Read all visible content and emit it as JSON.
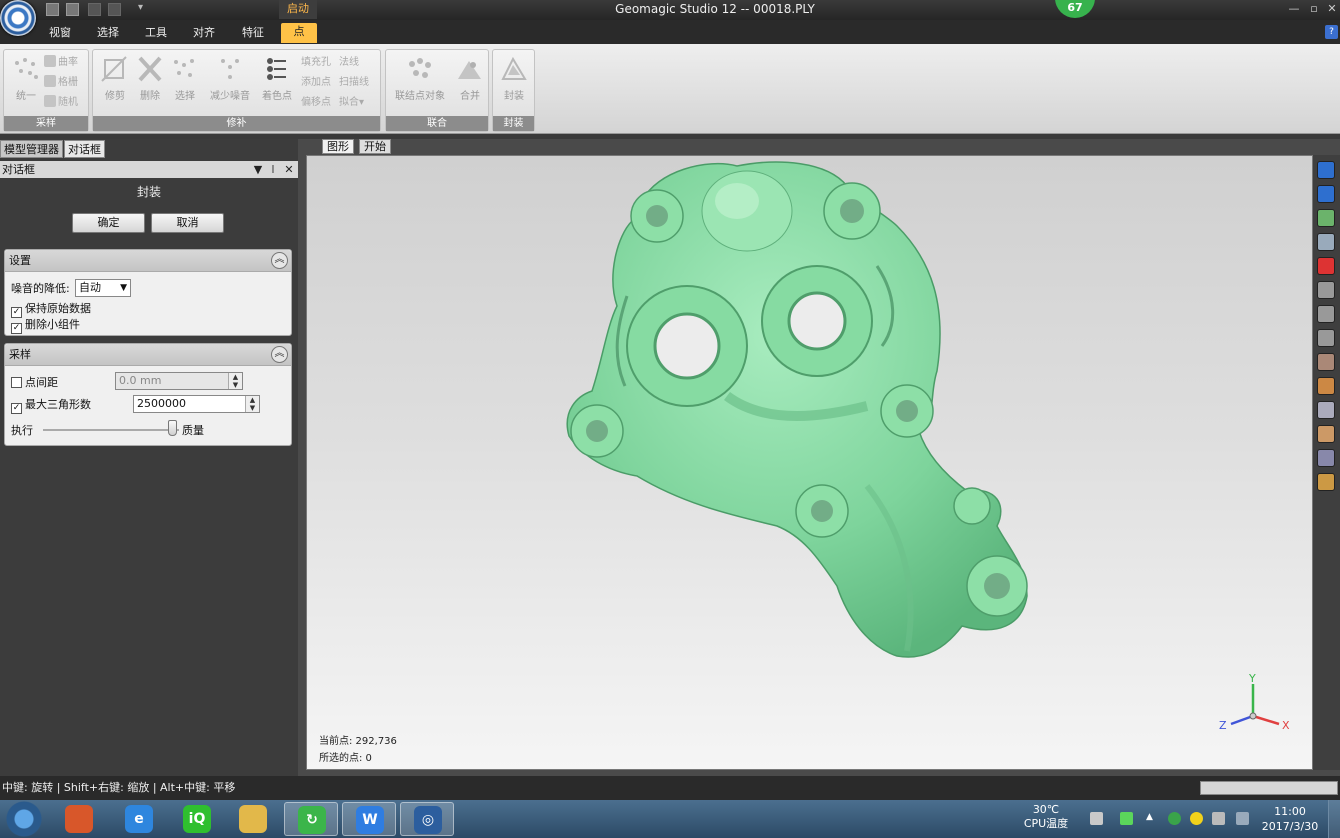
{
  "window": {
    "title": "Geomagic Studio 12 -- 00018.PLY",
    "badge": "67",
    "context_tab": "启动",
    "controls": [
      "—",
      "▫",
      "✕"
    ]
  },
  "ribbon_tabs": [
    {
      "label": "视窗"
    },
    {
      "label": "选择"
    },
    {
      "label": "工具"
    },
    {
      "label": "对齐"
    },
    {
      "label": "特征"
    },
    {
      "label": "点",
      "active": true
    }
  ],
  "help_label": "?",
  "ribbon": {
    "groups": {
      "sampling": {
        "label": "采样",
        "big": [
          "统一"
        ],
        "small": [
          "曲率",
          "格栅",
          "随机"
        ]
      },
      "repair": {
        "label": "修补",
        "big": [
          "修剪",
          "删除",
          "选择",
          "减少噪音",
          "着色点"
        ],
        "small": [
          "填充孔",
          "添加点",
          "偏移点",
          "法线",
          "扫描线",
          "拟合"
        ]
      },
      "union": {
        "label": "联合",
        "big": [
          "联结点对象",
          "合并"
        ]
      },
      "wrap": {
        "label": "封装",
        "big": [
          "封装"
        ]
      }
    }
  },
  "panel_tabs": [
    {
      "label": "模型管理器"
    },
    {
      "label": "对话框",
      "active": true
    }
  ],
  "dialog": {
    "header": "对话框",
    "header_icons": [
      "▼",
      "𝍷",
      "✕"
    ],
    "title": "封装",
    "ok": "确定",
    "cancel": "取消",
    "settings": {
      "title": "设置",
      "noise_label": "噪音的降低:",
      "noise_value": "自动",
      "keep_original": "保持原始数据",
      "remove_small": "删除小组件"
    },
    "sampling": {
      "title": "采样",
      "point_spacing_label": "点间距",
      "point_spacing_value": "0.0 mm",
      "max_triangles_label": "最大三角形数",
      "max_triangles_value": "2500000",
      "perf_label": "执行",
      "quality_label": "质量",
      "slider_value": 0.95
    }
  },
  "viewport": {
    "tabs": [
      {
        "label": "图形",
        "active": true
      },
      {
        "label": "开始"
      }
    ],
    "current_points": "当前点: 292,736",
    "selected_points": "所选的点: 0",
    "axes": {
      "x": "X",
      "y": "Y",
      "z": "Z"
    },
    "model_color": "#7ed49c",
    "toolbar_colors": [
      "#2e6fcf",
      "#2e6fcf",
      "#6bb36b",
      "#9ab",
      "#d33",
      "#999",
      "#999",
      "#999",
      "#a87",
      "#c84",
      "#aab",
      "#c96",
      "#88a",
      "#c94"
    ]
  },
  "statusbar": {
    "text": "中键: 旋转 | Shift+右键: 缩放 | Alt+中键: 平移"
  },
  "taskbar": {
    "items": [
      {
        "icon": "color-pinwheel-icon",
        "glyph": "",
        "color": "#d8572a"
      },
      {
        "icon": "ie-icon",
        "glyph": "e",
        "color": "#2e86de"
      },
      {
        "icon": "iqiyi-icon",
        "glyph": "iQ",
        "color": "#2fbf2f"
      },
      {
        "icon": "folder-icon",
        "glyph": "",
        "color": "#e2b84a"
      },
      {
        "icon": "refresh-green-icon",
        "glyph": "↻",
        "color": "#3bb54a",
        "active": true
      },
      {
        "icon": "wps-icon",
        "glyph": "W",
        "color": "#2f7de1",
        "active": true
      },
      {
        "icon": "geomagic-icon",
        "glyph": "◎",
        "color": "#2c5e9e",
        "active": true
      }
    ],
    "temp": "30℃",
    "temp_label": "CPU温度",
    "time": "11:00",
    "date": "2017/3/30"
  }
}
